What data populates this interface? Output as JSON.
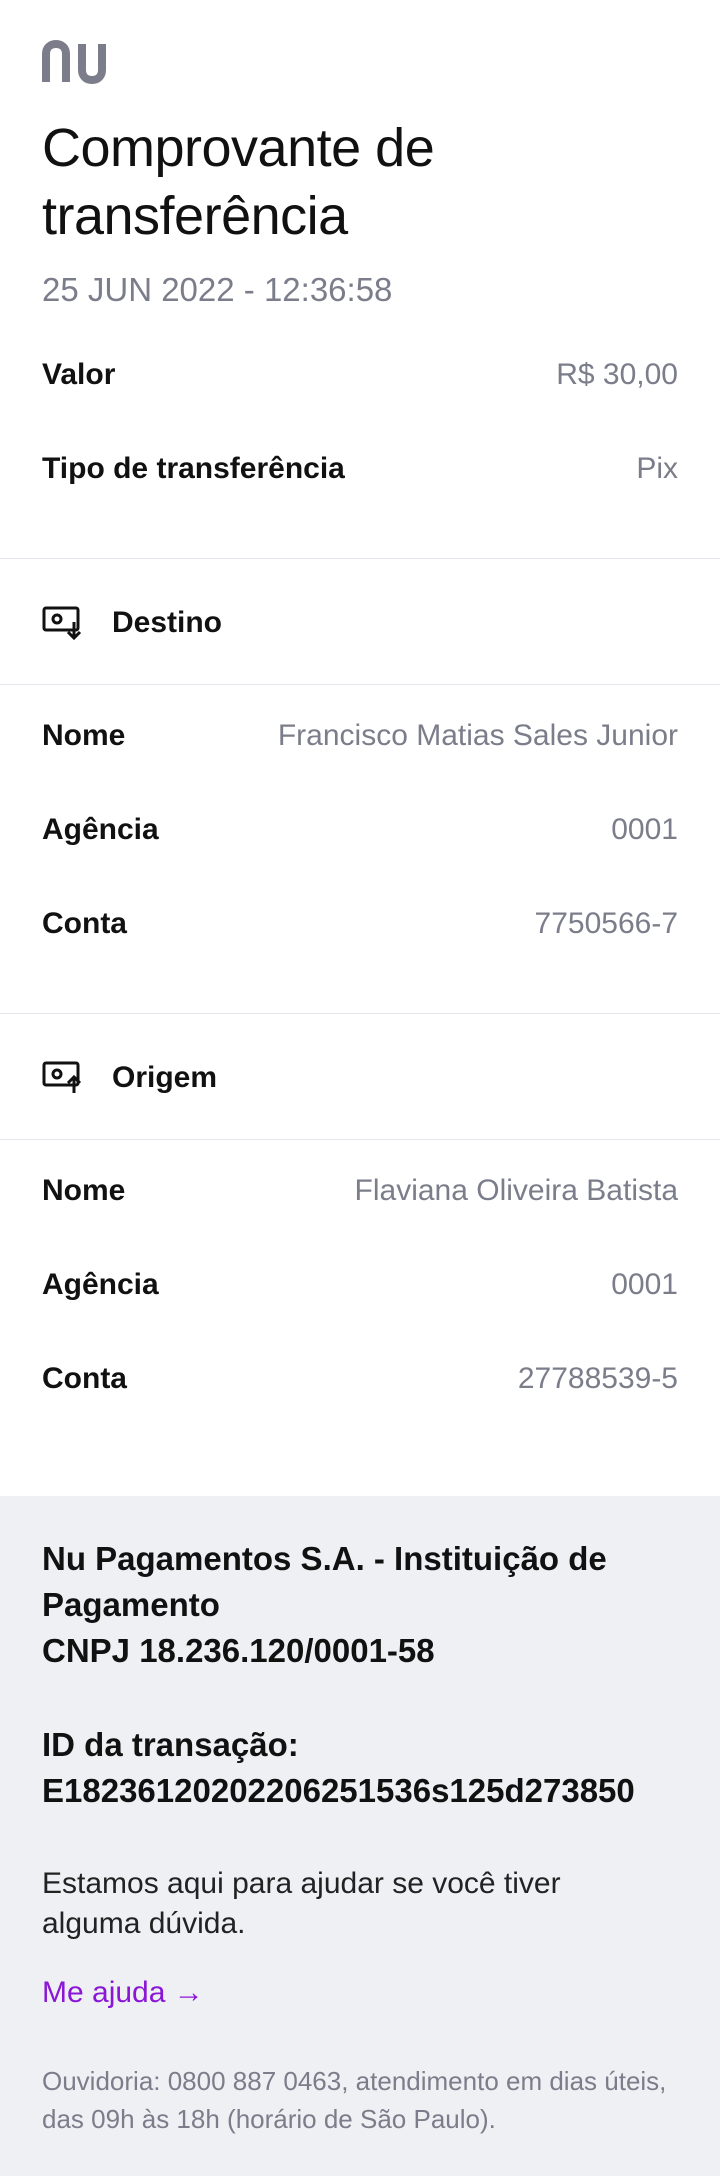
{
  "brand": {
    "logo_text": "nu",
    "logo_color": "#7b7d8a"
  },
  "header": {
    "title": "Comprovante de transferência",
    "datetime": "25 JUN 2022 - 12:36:58"
  },
  "summary": [
    {
      "label": "Valor",
      "value": "R$ 30,00"
    },
    {
      "label": "Tipo de transferência",
      "value": "Pix"
    }
  ],
  "destination": {
    "title": "Destino",
    "icon": "money-in-icon",
    "fields": [
      {
        "label": "Nome",
        "value": "Francisco Matias Sales Junior"
      },
      {
        "label": "Agência",
        "value": "0001"
      },
      {
        "label": "Conta",
        "value": "7750566-7"
      }
    ]
  },
  "origin": {
    "title": "Origem",
    "icon": "money-out-icon",
    "fields": [
      {
        "label": "Nome",
        "value": "Flaviana Oliveira Batista"
      },
      {
        "label": "Agência",
        "value": "0001"
      },
      {
        "label": "Conta",
        "value": "27788539-5"
      }
    ]
  },
  "footer": {
    "company_line1": "Nu Pagamentos S.A. - Instituição de Pagamento",
    "company_line2": "CNPJ 18.236.120/0001-58",
    "transaction_label": "ID da transação:",
    "transaction_id": "E18236120202206251536s125d273850",
    "help_text": "Estamos aqui para ajudar se você tiver alguma dúvida.",
    "help_link": "Me ajuda →",
    "ombudsman": "Ouvidoria: 0800 887 0463, atendimento em dias úteis, das 09h às 18h (horário de São Paulo)."
  },
  "colors": {
    "accent": "#8a16d6",
    "muted": "#7b7d8a",
    "footer_bg": "#eef0f4"
  }
}
